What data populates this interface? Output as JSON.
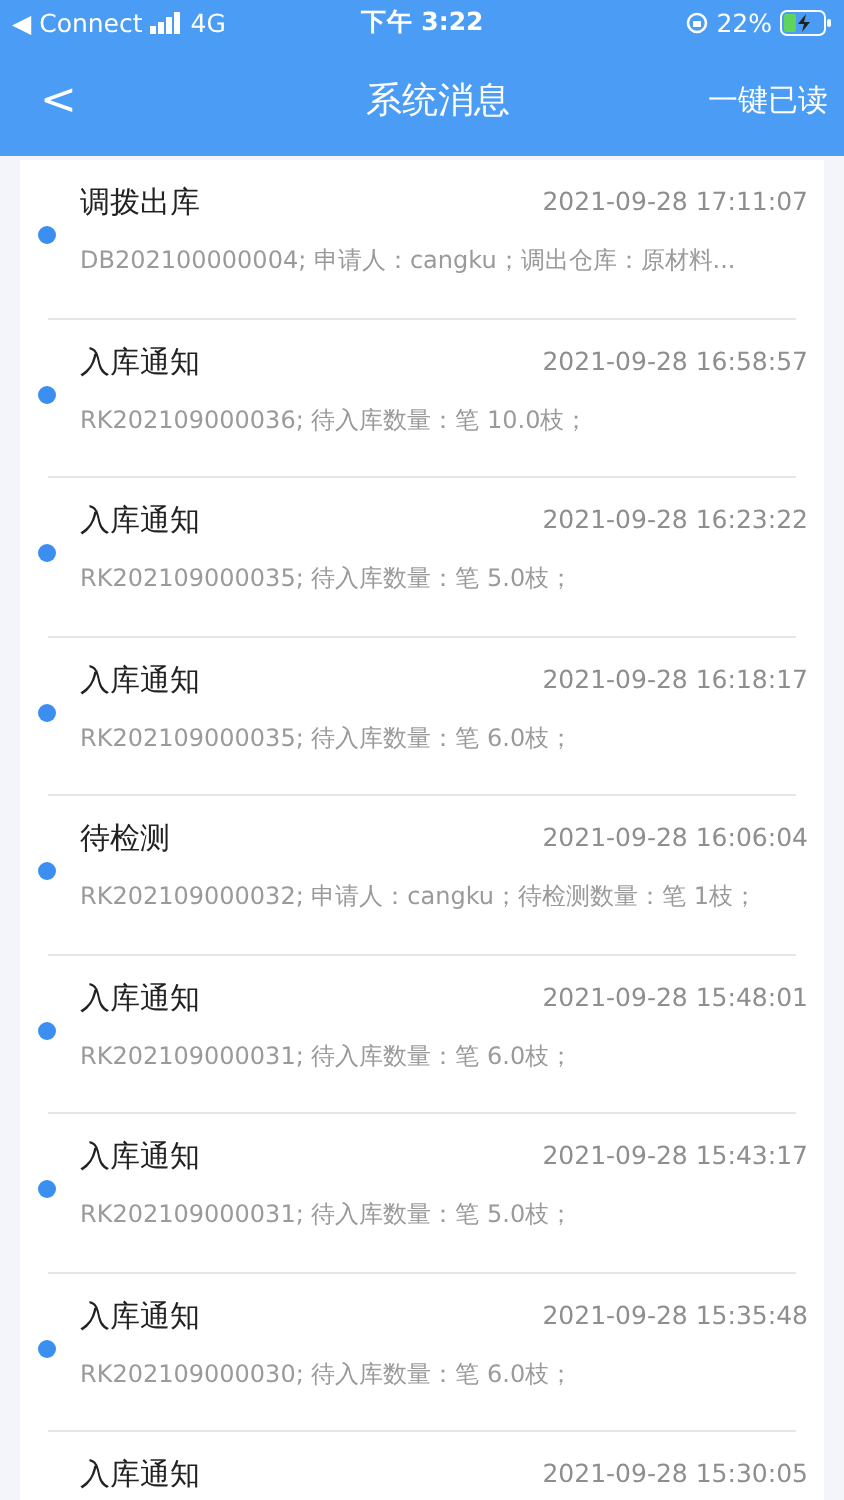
{
  "status_bar": {
    "carrier": "◀ Connect",
    "network": "4G",
    "time": "下午 3:22",
    "battery": "22%"
  },
  "header": {
    "back": "<",
    "title": "系统消息",
    "action": "一键已读"
  },
  "messages": [
    {
      "title": "调拨出库",
      "time": "2021-09-28 17:11:07",
      "detail": "DB202100000004; 申请人：cangku；调出仓库：原材料...",
      "unread": true
    },
    {
      "title": "入库通知",
      "time": "2021-09-28 16:58:57",
      "detail": "RK202109000036; 待入库数量：笔 10.0枝；",
      "unread": true
    },
    {
      "title": "入库通知",
      "time": "2021-09-28 16:23:22",
      "detail": "RK202109000035; 待入库数量：笔 5.0枝；",
      "unread": true
    },
    {
      "title": "入库通知",
      "time": "2021-09-28 16:18:17",
      "detail": "RK202109000035; 待入库数量：笔 6.0枝；",
      "unread": true
    },
    {
      "title": "待检测",
      "time": "2021-09-28 16:06:04",
      "detail": "RK202109000032; 申请人：cangku；待检测数量：笔 1枝；",
      "unread": true
    },
    {
      "title": "入库通知",
      "time": "2021-09-28 15:48:01",
      "detail": "RK202109000031; 待入库数量：笔 6.0枝；",
      "unread": true
    },
    {
      "title": "入库通知",
      "time": "2021-09-28 15:43:17",
      "detail": "RK202109000031; 待入库数量：笔 5.0枝；",
      "unread": true
    },
    {
      "title": "入库通知",
      "time": "2021-09-28 15:35:48",
      "detail": "RK202109000030; 待入库数量：笔 6.0枝；",
      "unread": true
    },
    {
      "title": "入库通知",
      "time": "2021-09-28 15:30:05"
    }
  ]
}
